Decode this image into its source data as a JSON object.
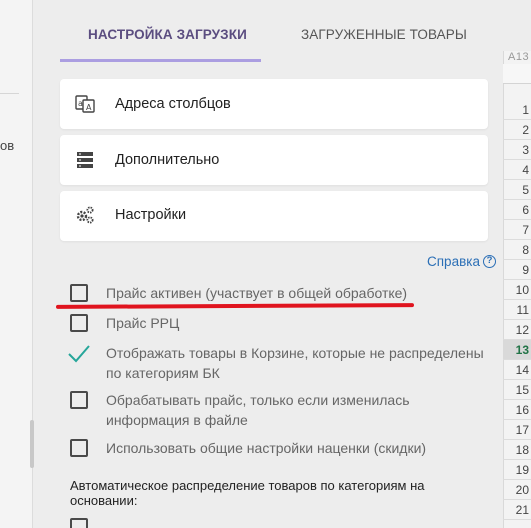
{
  "left_panel": {
    "text": "ов"
  },
  "tabs": [
    {
      "label": "НАСТРОЙКА ЗАГРУЗКИ",
      "active": true
    },
    {
      "label": "ЗАГРУЖЕННЫЕ ТОВАРЫ",
      "active": false
    }
  ],
  "cards": [
    {
      "label": "Адреса столбцов",
      "icon": "translate-icon"
    },
    {
      "label": "Дополнительно",
      "icon": "server-icon"
    },
    {
      "label": "Настройки",
      "icon": "gears-icon"
    }
  ],
  "help": {
    "label": "Справка",
    "icon": "?"
  },
  "checkboxes": [
    {
      "label": "Прайс активен (участвует в общей обработке)",
      "checked": false
    },
    {
      "label": "Прайс РРЦ",
      "checked": false
    },
    {
      "label_line1": "Отображать товары в Корзине, которые не распределены",
      "label_line2": "по категориям БК",
      "checked": true
    },
    {
      "label_line1": "Обрабатывать прайс, только если изменилась",
      "label_line2": "информация в файле",
      "checked": false
    },
    {
      "label": "Использовать общие настройки наценки (скидки)",
      "checked": false
    }
  ],
  "auto_section": {
    "line1": "Автоматическое распределение товаров по категориям на",
    "line2": "основании:"
  },
  "spreadsheet": {
    "name_box": "A13",
    "rows": [
      "1",
      "2",
      "3",
      "4",
      "5",
      "6",
      "7",
      "8",
      "9",
      "10",
      "11",
      "12",
      "13",
      "14",
      "15",
      "16",
      "17",
      "18",
      "19",
      "20",
      "21"
    ],
    "selected_row": "13"
  },
  "colors": {
    "accent": "#5b4d80",
    "tab_underline": "#ab9ee1",
    "help_link": "#2b6fb6",
    "check": "#26a69a",
    "annotation": "#e0141e"
  }
}
